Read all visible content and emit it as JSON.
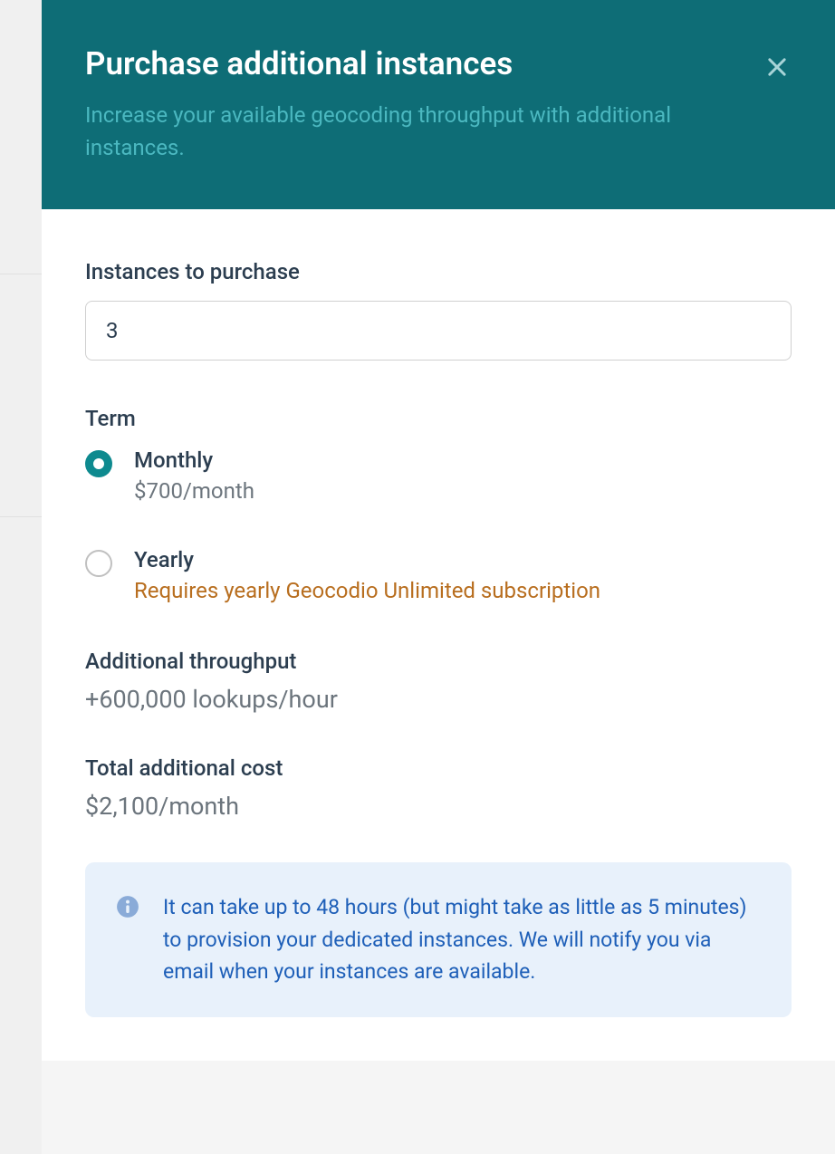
{
  "header": {
    "title": "Purchase additional instances",
    "subtitle": "Increase your available geocoding throughput with additional instances."
  },
  "form": {
    "instances_label": "Instances to purchase",
    "instances_value": "3",
    "term_label": "Term",
    "term_options": [
      {
        "label": "Monthly",
        "sublabel": "$700/month",
        "selected": true
      },
      {
        "label": "Yearly",
        "sublabel": "Requires yearly Geocodio Unlimited subscription",
        "selected": false
      }
    ]
  },
  "summary": {
    "throughput_label": "Additional throughput",
    "throughput_value": "+600,000 lookups/hour",
    "cost_label": "Total additional cost",
    "cost_value": "$2,100/month"
  },
  "info": {
    "text": "It can take up to 48 hours (but might take as little as 5 minutes) to provision your dedicated instances. We will notify you via email when your instances are available."
  }
}
